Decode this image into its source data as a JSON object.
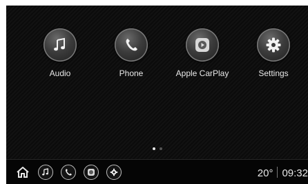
{
  "apps": [
    {
      "label": "Audio",
      "icon": "music-note-icon"
    },
    {
      "label": "Phone",
      "icon": "phone-handset-icon"
    },
    {
      "label": "Apple CarPlay",
      "icon": "carplay-icon"
    },
    {
      "label": "Settings",
      "icon": "gear-icon"
    }
  ],
  "pager": {
    "current_page": 1,
    "total_pages": 2
  },
  "bottom_bar": {
    "home_icon": "home-icon",
    "shortcuts": [
      "music-note-icon",
      "phone-handset-icon",
      "carplay-icon",
      "gear-icon"
    ],
    "temperature": "20°",
    "time": "09:32"
  },
  "colors": {
    "background": "#0f0f0f",
    "text": "#e8e8e8",
    "button_border": "#bdbdbd"
  }
}
